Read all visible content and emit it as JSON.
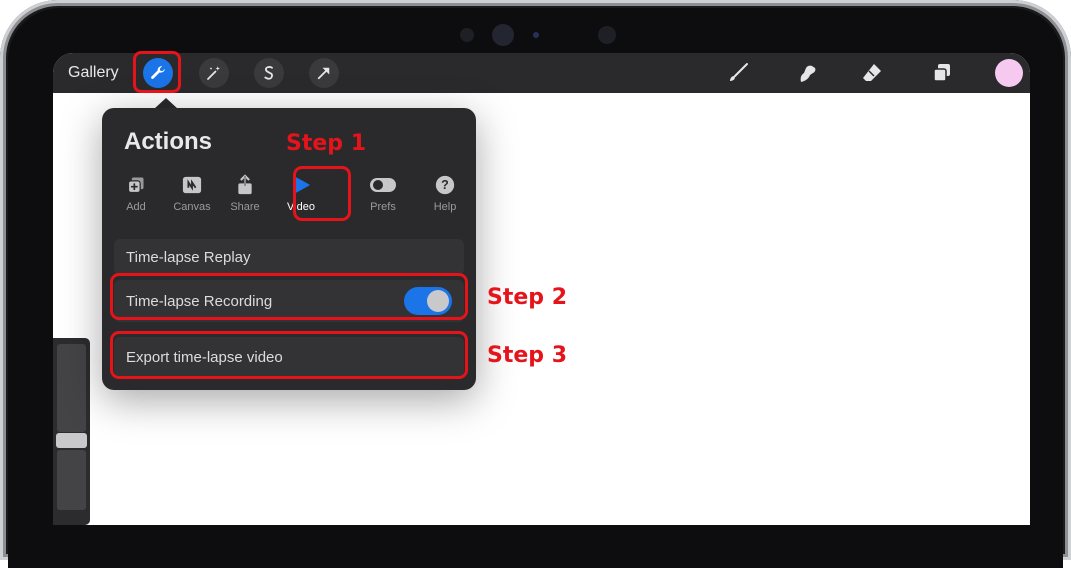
{
  "toolbar": {
    "gallery_label": "Gallery",
    "left_tools": [
      {
        "name": "actions",
        "icon": "wrench-icon",
        "active": true
      },
      {
        "name": "adjustments",
        "icon": "magic-wand-icon"
      },
      {
        "name": "selection",
        "icon": "selection-icon"
      },
      {
        "name": "transform",
        "icon": "arrow-cursor-icon"
      }
    ],
    "right_tools": [
      {
        "name": "brush",
        "icon": "brush-icon"
      },
      {
        "name": "smudge",
        "icon": "smudge-icon"
      },
      {
        "name": "eraser",
        "icon": "eraser-icon"
      },
      {
        "name": "layers",
        "icon": "layers-icon"
      }
    ],
    "current_color": "#f6c9f0",
    "accent": "#1b74e8"
  },
  "actions_panel": {
    "title": "Actions",
    "tabs": [
      {
        "label": "Add",
        "icon": "add-icon"
      },
      {
        "label": "Canvas",
        "icon": "canvas-icon"
      },
      {
        "label": "Share",
        "icon": "share-icon"
      },
      {
        "label": "Video",
        "icon": "play-icon",
        "selected": true
      },
      {
        "label": "Prefs",
        "icon": "toggle-icon"
      },
      {
        "label": "Help",
        "icon": "help-icon"
      }
    ],
    "rows": [
      {
        "label": "Time-lapse Replay"
      },
      {
        "label": "Time-lapse Recording",
        "toggle_on": true
      },
      {
        "label": "Export time-lapse video"
      }
    ]
  },
  "annotations": {
    "step1": "Step 1",
    "step2": "Step 2",
    "step3": "Step 3",
    "highlight_color": "#e5141b"
  }
}
